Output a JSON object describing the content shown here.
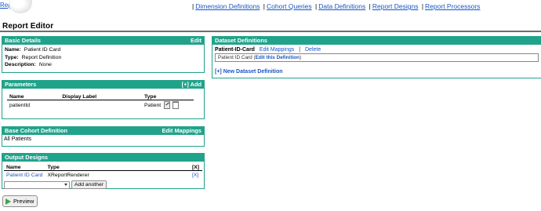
{
  "nav": {
    "partial_link": "Repo",
    "links": [
      "Dimension Definitions",
      "Cohort Queries",
      "Data Definitions",
      "Report Designs",
      "Report Processors"
    ]
  },
  "page_title": "Report Editor",
  "basic_details": {
    "header": "Basic Details",
    "edit": "Edit",
    "name_label": "Name:",
    "name_value": "Patient ID Card",
    "type_label": "Type:",
    "type_value": "Report Definition",
    "desc_label": "Description:",
    "desc_value": "None"
  },
  "parameters": {
    "header": "Parameters",
    "add": "[+] Add",
    "columns": [
      "Name",
      "Display Label",
      "Type"
    ],
    "rows": [
      {
        "name": "patientId",
        "display_label": "",
        "type": "Patient"
      }
    ]
  },
  "base_cohort": {
    "header": "Base Cohort Definition",
    "edit": "Edit Mappings",
    "value": "All Patients"
  },
  "output_designs": {
    "header": "Output Designs",
    "columns": [
      "Name",
      "Type",
      "[X]"
    ],
    "rows": [
      {
        "name": "Patient ID Card",
        "type": "XReportRenderer",
        "remove": "[X]"
      }
    ],
    "add_button": "Add another"
  },
  "dataset_definitions": {
    "header": "Dataset Definitions",
    "dataset_name": "Patient-ID-Card",
    "edit_mappings": "Edit Mappings",
    "separator": "|",
    "delete": "Delete",
    "detail_prefix": "Patient ID Card (",
    "detail_link": "Edit this Definition",
    "detail_suffix": ")",
    "new_link": "[+] New Dataset Definition"
  },
  "preview_button": "Preview",
  "colors": {
    "panel_header": "#20a38a",
    "link": "#1a55c4",
    "preview_icon": "#3aa64a"
  }
}
